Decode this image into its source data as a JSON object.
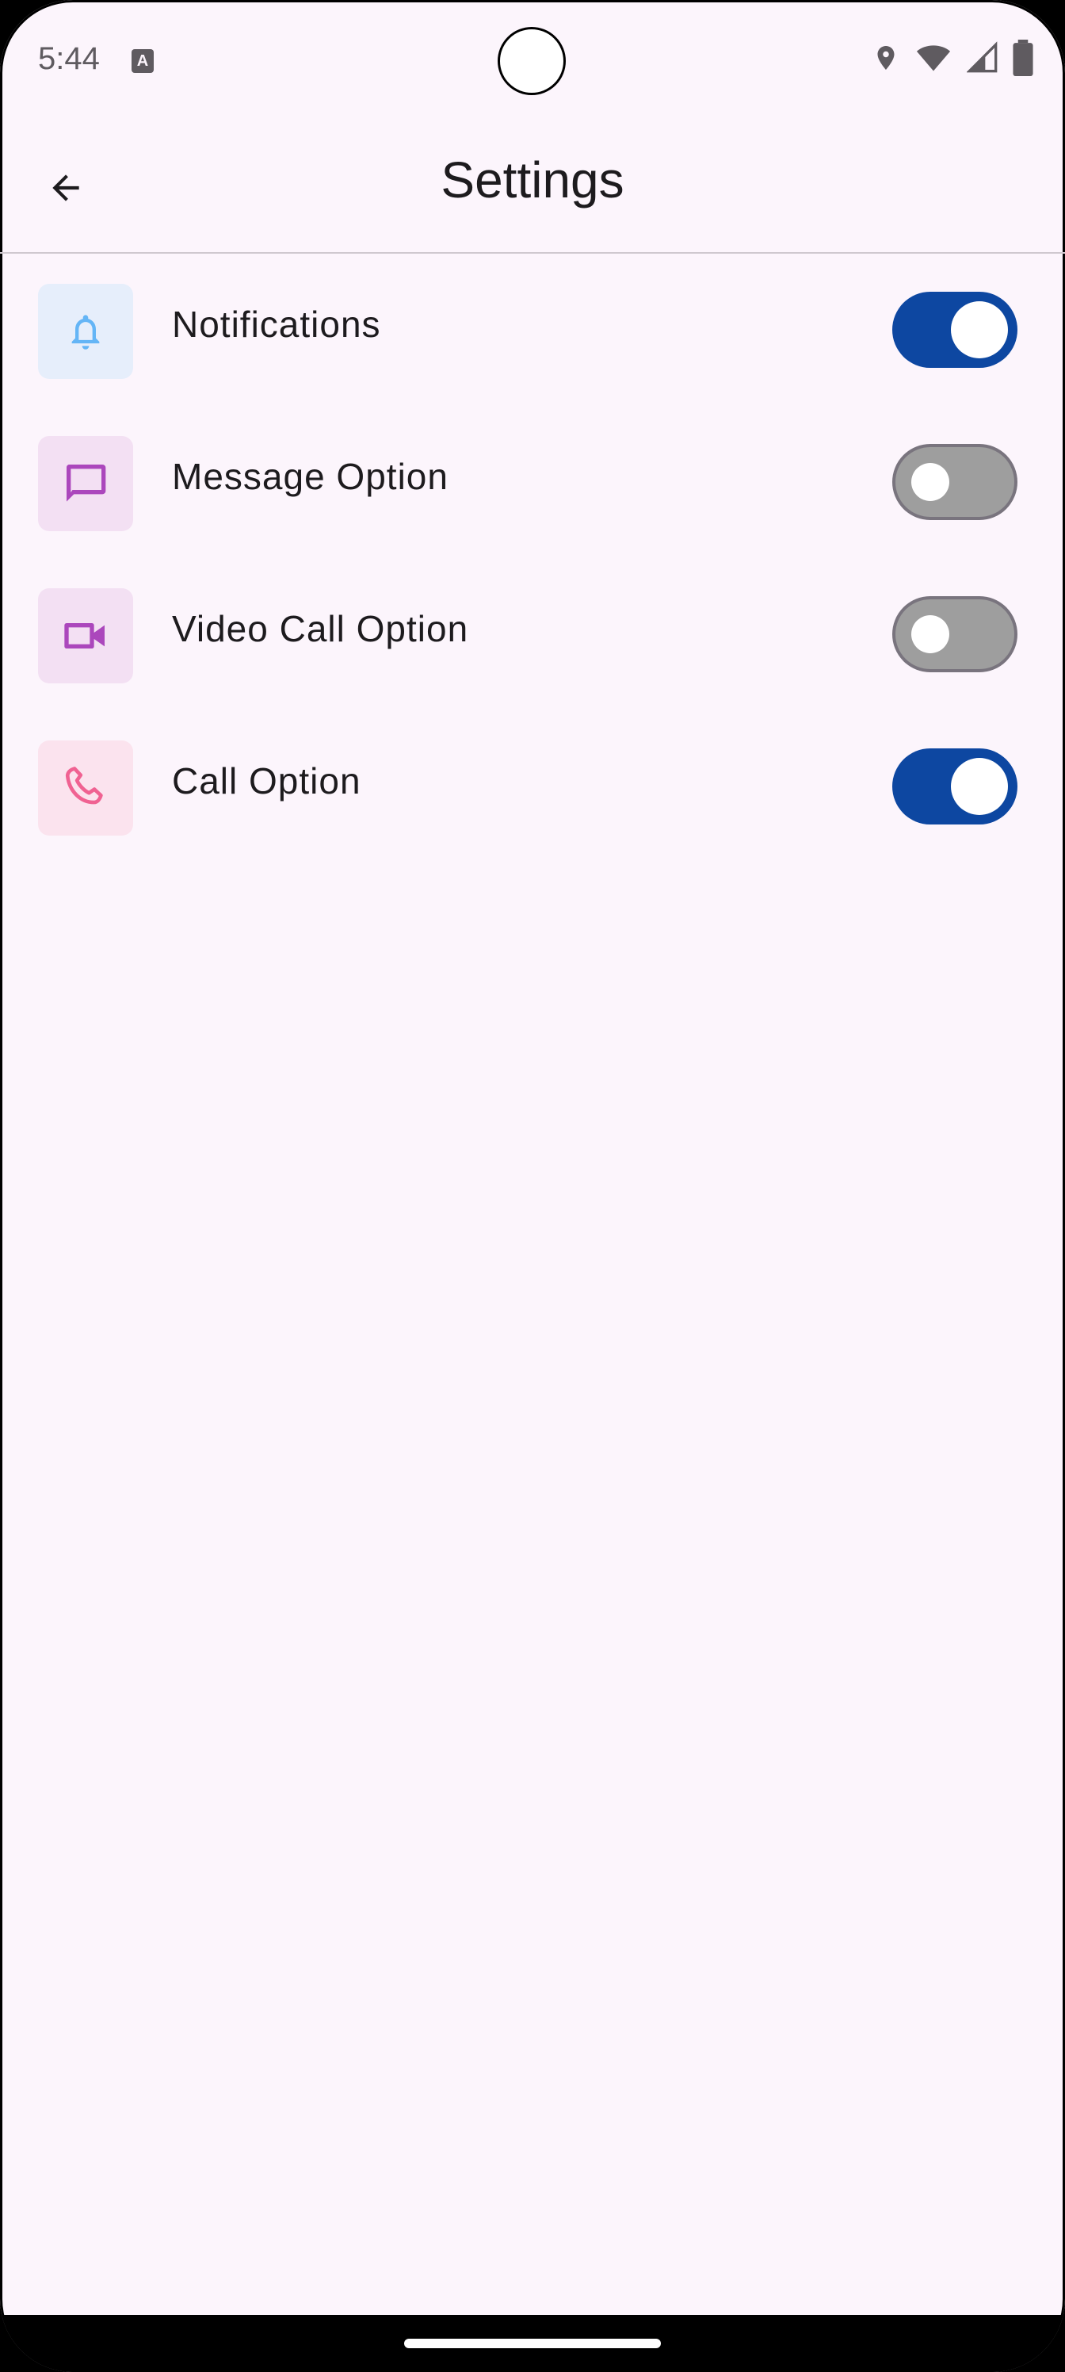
{
  "status_bar": {
    "time": "5:44",
    "notification_icon": "A",
    "icons": [
      "location-icon",
      "wifi-icon",
      "signal-icon",
      "battery-icon"
    ]
  },
  "app_bar": {
    "title": "Settings",
    "back_icon": "arrow-left-icon"
  },
  "settings": [
    {
      "label": "Notifications",
      "icon": "bell-icon",
      "icon_color": "#64b5f6",
      "icon_bg": "#e6eefb",
      "enabled": true
    },
    {
      "label": "Message Option",
      "icon": "message-icon",
      "icon_color": "#ab47bc",
      "icon_bg": "#f3e0f3",
      "enabled": false
    },
    {
      "label": "Video Call Option",
      "icon": "video-camera-icon",
      "icon_color": "#ab47bc",
      "icon_bg": "#f3e0f3",
      "enabled": false
    },
    {
      "label": "Call Option",
      "icon": "phone-icon",
      "icon_color": "#f06292",
      "icon_bg": "#fbe3ee",
      "enabled": true
    }
  ],
  "colors": {
    "background": "#fcf5fc",
    "switch_on": "#0d47a1",
    "switch_off": "#9e9e9e"
  }
}
